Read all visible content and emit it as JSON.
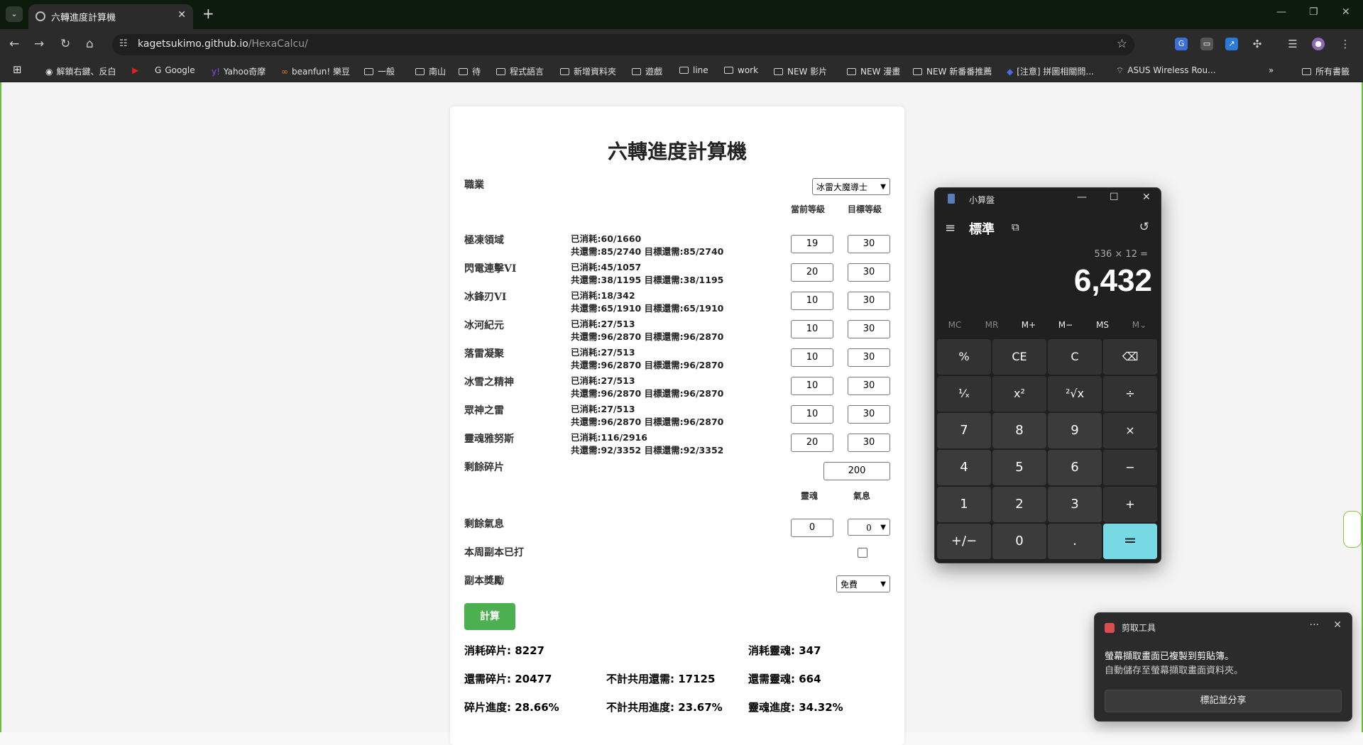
{
  "browser": {
    "tab_title": "六轉進度計算機",
    "url_host": "kagetsukimo.github.io",
    "url_path": "/HexaCalcu/",
    "bookmarks": [
      "解鎖右鍵、反白",
      "Google",
      "Yahoo奇摩",
      "beanfun! 樂豆",
      "一般",
      "南山",
      "待",
      "程式語言",
      "新增資料夾",
      "遊戲",
      "line",
      "work",
      "NEW 影片",
      "NEW 漫畫",
      "NEW 新番番推薦",
      "[注意] 拼圖相關問...",
      "ASUS Wireless Rou..."
    ],
    "bookmarks_all": "所有書籤"
  },
  "page": {
    "title": "六轉進度計算機",
    "job_label": "職業",
    "job_value": "冰雷大魔導士",
    "col_current": "當前等級",
    "col_target": "目標等級",
    "skills": [
      {
        "name": "極凍領域",
        "used": "已消耗:60/1660",
        "need": "共還需:85/2740 目標還需:85/2740",
        "cur": "19",
        "tgt": "30"
      },
      {
        "name": "閃電連擊VI",
        "used": "已消耗:45/1057",
        "need": "共還需:38/1195 目標還需:38/1195",
        "cur": "20",
        "tgt": "30"
      },
      {
        "name": "冰鋒刃VI",
        "used": "已消耗:18/342",
        "need": "共還需:65/1910 目標還需:65/1910",
        "cur": "10",
        "tgt": "30"
      },
      {
        "name": "冰河紀元",
        "used": "已消耗:27/513",
        "need": "共還需:96/2870 目標還需:96/2870",
        "cur": "10",
        "tgt": "30"
      },
      {
        "name": "落雷凝聚",
        "used": "已消耗:27/513",
        "need": "共還需:96/2870 目標還需:96/2870",
        "cur": "10",
        "tgt": "30"
      },
      {
        "name": "冰雪之精神",
        "used": "已消耗:27/513",
        "need": "共還需:96/2870 目標還需:96/2870",
        "cur": "10",
        "tgt": "30"
      },
      {
        "name": "眾神之雷",
        "used": "已消耗:27/513",
        "need": "共還需:96/2870 目標還需:96/2870",
        "cur": "10",
        "tgt": "30"
      },
      {
        "name": "靈魂雅努斯",
        "used": "已消耗:116/2916",
        "need": "共還需:92/3352 目標還需:92/3352",
        "cur": "20",
        "tgt": "30"
      }
    ],
    "fragments_label": "剩餘碎片",
    "fragments_value": "200",
    "col_soul": "靈魂",
    "col_aura": "氣息",
    "aura_label": "剩餘氣息",
    "aura_soul_value": "0",
    "aura_value": "0",
    "weekly_label": "本周副本已打",
    "reward_label": "副本獎勵",
    "reward_value": "免費",
    "calc_button": "計算",
    "results": {
      "r1a": "消耗碎片: 8227",
      "r1c": "消耗靈魂: 347",
      "r2a": "還需碎片: 20477",
      "r2b": "不計共用還需: 17125",
      "r2c": "還需靈魂: 664",
      "r3a": "碎片進度: 28.66%",
      "r3b": "不計共用進度: 23.67%",
      "r3c": "靈魂進度: 34.32%"
    }
  },
  "calculator": {
    "window_title": "小算盤",
    "mode": "標準",
    "expression": "536 × 12 =",
    "display": "6,432",
    "memory": [
      "MC",
      "MR",
      "M+",
      "M−",
      "MS",
      "M⌄"
    ],
    "keys": [
      "%",
      "CE",
      "C",
      "⌫",
      "¹⁄ₓ",
      "x²",
      "²√x",
      "÷",
      "7",
      "8",
      "9",
      "×",
      "4",
      "5",
      "6",
      "−",
      "1",
      "2",
      "3",
      "+",
      "+/−",
      "0",
      ".",
      "="
    ]
  },
  "notification": {
    "app": "剪取工具",
    "line1": "螢幕擷取畫面已複製到剪貼簿。",
    "line2": "自動儲存至螢幕擷取畫面資料夾。",
    "button": "標記並分享"
  }
}
